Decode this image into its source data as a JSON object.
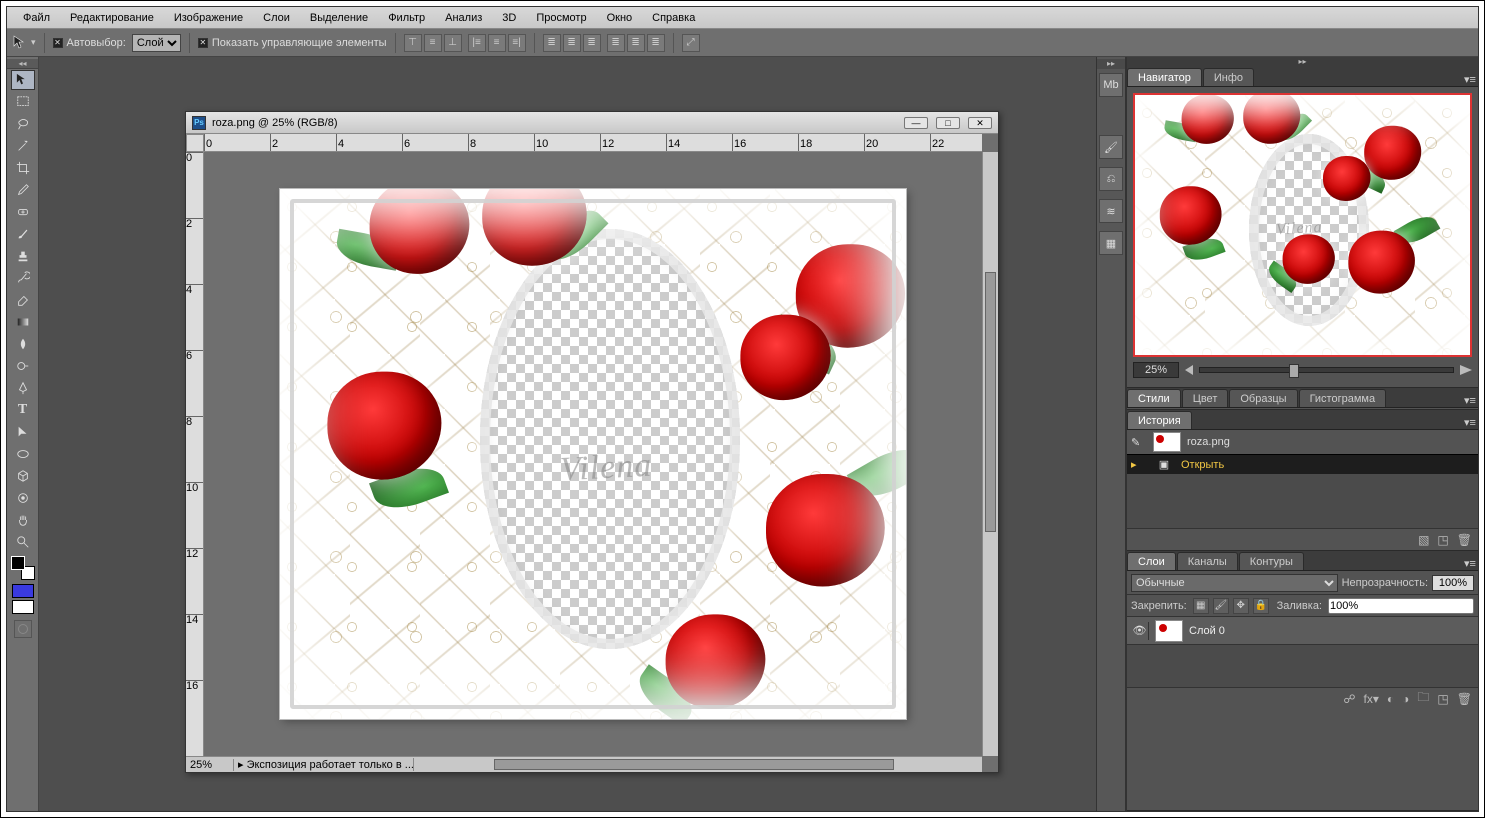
{
  "menu": [
    "Файл",
    "Редактирование",
    "Изображение",
    "Слои",
    "Выделение",
    "Фильтр",
    "Анализ",
    "3D",
    "Просмотр",
    "Окно",
    "Справка"
  ],
  "options": {
    "autoselect_label": "Автовыбор:",
    "autoselect_value": "Слой",
    "show_controls_label": "Показать управляющие элементы"
  },
  "document": {
    "title": "roza.png @ 25% (RGB/8)",
    "zoom": "25%",
    "status": "Экспозиция работает только в ...",
    "ruler_h": [
      "0",
      "2",
      "4",
      "6",
      "8",
      "10",
      "12",
      "14",
      "16",
      "18",
      "20",
      "22"
    ],
    "ruler_v": [
      "0",
      "2",
      "4",
      "6",
      "8",
      "10",
      "12",
      "14",
      "16"
    ],
    "watermark": "Vilena"
  },
  "panels": {
    "nav_tabs": [
      "Навигатор",
      "Инфо"
    ],
    "nav_zoom": "25%",
    "style_tabs": [
      "Стили",
      "Цвет",
      "Образцы",
      "Гистограмма"
    ],
    "history_tab": "История",
    "history_doc": "roza.png",
    "history_step": "Открыть",
    "layers_tabs": [
      "Слои",
      "Каналы",
      "Контуры"
    ],
    "blend_mode": "Обычные",
    "opacity_label": "Непрозрачность:",
    "opacity_value": "100%",
    "lock_label": "Закрепить:",
    "fill_label": "Заливка:",
    "fill_value": "100%",
    "layer0": "Слой 0"
  }
}
